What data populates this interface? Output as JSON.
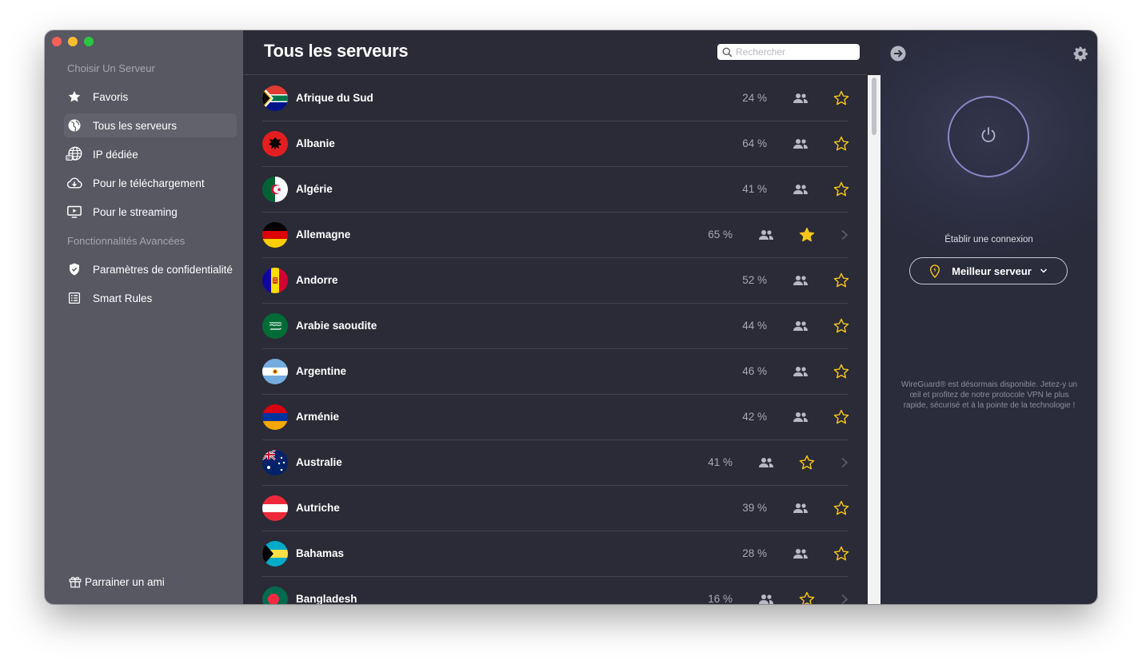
{
  "sidebar": {
    "section_choose": "Choisir Un Serveur",
    "section_advanced": "Fonctionnalités Avancées",
    "items": [
      {
        "label": "Favoris",
        "icon": "star-icon"
      },
      {
        "label": "Tous les serveurs",
        "icon": "globe-icon",
        "active": true
      },
      {
        "label": "IP dédiée",
        "icon": "dedicated-ip-globe-icon"
      },
      {
        "label": "Pour le téléchargement",
        "icon": "cloud-download-icon"
      },
      {
        "label": "Pour le streaming",
        "icon": "tv-play-icon"
      }
    ],
    "advanced_items": [
      {
        "label": "Paramètres de confidentialité",
        "icon": "shield-check-icon"
      },
      {
        "label": "Smart Rules",
        "icon": "rules-list-icon"
      }
    ],
    "refer_label": "Parrainer un ami"
  },
  "main": {
    "title": "Tous les serveurs",
    "search_placeholder": "Rechercher",
    "servers": [
      {
        "name": "Afrique du Sud",
        "load": "24 %",
        "favorite": false,
        "chevron": false
      },
      {
        "name": "Albanie",
        "load": "64 %",
        "favorite": false,
        "chevron": false
      },
      {
        "name": "Algérie",
        "load": "41 %",
        "favorite": false,
        "chevron": false
      },
      {
        "name": "Allemagne",
        "load": "65 %",
        "favorite": true,
        "chevron": true
      },
      {
        "name": "Andorre",
        "load": "52 %",
        "favorite": false,
        "chevron": false
      },
      {
        "name": "Arabie saoudite",
        "load": "44 %",
        "favorite": false,
        "chevron": false
      },
      {
        "name": "Argentine",
        "load": "46 %",
        "favorite": false,
        "chevron": false
      },
      {
        "name": "Arménie",
        "load": "42 %",
        "favorite": false,
        "chevron": false
      },
      {
        "name": "Australie",
        "load": "41 %",
        "favorite": false,
        "chevron": true
      },
      {
        "name": "Autriche",
        "load": "39 %",
        "favorite": false,
        "chevron": false
      },
      {
        "name": "Bahamas",
        "load": "28 %",
        "favorite": false,
        "chevron": false
      },
      {
        "name": "Bangladesh",
        "load": "16 %",
        "favorite": false,
        "chevron": true
      }
    ]
  },
  "panel": {
    "connect_label": "Établir une connexion",
    "best_server_label": "Meilleur serveur",
    "wireguard_note": "WireGuard® est désormais disponible. Jetez-y un œil et profitez de notre protocole VPN le plus rapide, sécurisé et à la pointe de la technologie !"
  },
  "colors": {
    "sidebar_bg": "#585862",
    "main_bg": "#2a2b36",
    "panel_bg": "#2e3044",
    "accent_star": "#f5c518",
    "power_ring": "#8b86c7"
  }
}
